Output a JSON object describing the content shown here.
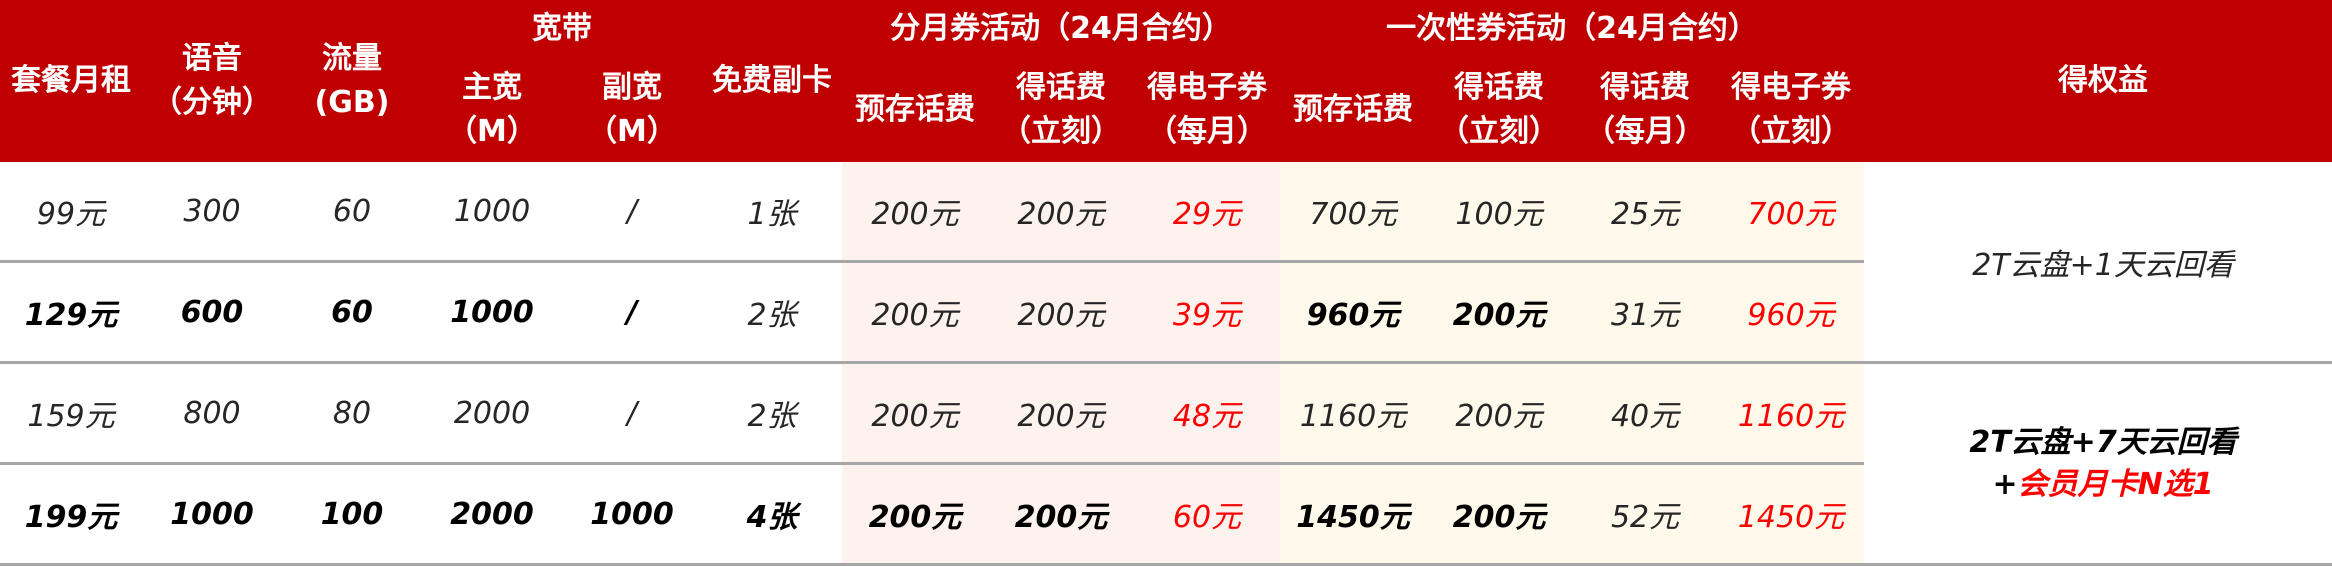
{
  "headers": {
    "monthly_fee": "套餐月租",
    "voice_l1": "语音",
    "voice_l2": "（分钟）",
    "data_l1": "流量",
    "data_l2": "(GB)",
    "broadband": "宽带",
    "main_bw_l1": "主宽",
    "main_bw_l2": "（M）",
    "sub_bw_l1": "副宽",
    "sub_bw_l2": "（M）",
    "free_card": "免费副卡",
    "monthly_coupon": "分月券活动（24月合约）",
    "onetime_coupon": "一次性券活动（24月合约）",
    "prestore": "预存话费",
    "get_fee_l1": "得话费",
    "get_fee_l2": "（立刻）",
    "get_ecoupon_l1": "得电子券",
    "get_ecoupon_monthly_l2": "（每月）",
    "prestore2": "预存话费",
    "get_fee2_l1": "得话费",
    "get_fee2_l2": "（立刻）",
    "get_fee3_l1": "得话费",
    "get_fee3_l2": "（每月）",
    "get_ecoupon2_l1": "得电子券",
    "get_ecoupon2_l2": "（立刻）",
    "benefit": "得权益"
  },
  "rows": [
    [
      "99元",
      "300",
      "60",
      "1000",
      "/",
      "1张",
      "200元",
      "200元",
      "29元",
      "700元",
      "100元",
      "25元",
      "700元"
    ],
    [
      "129元",
      "600",
      "60",
      "1000",
      "/",
      "2张",
      "200元",
      "200元",
      "39元",
      "960元",
      "200元",
      "31元",
      "960元"
    ],
    [
      "159元",
      "800",
      "80",
      "2000",
      "/",
      "2张",
      "200元",
      "200元",
      "48元",
      "1160元",
      "200元",
      "40元",
      "1160元"
    ],
    [
      "199元",
      "1000",
      "100",
      "2000",
      "1000",
      "4张",
      "200元",
      "200元",
      "60元",
      "1450元",
      "200元",
      "52元",
      "1450元"
    ]
  ],
  "benefits": {
    "group1": "2T云盘+1天云回看",
    "group2_l1": "2T云盘+7天云回看",
    "group2_l2_prefix": "+",
    "group2_l2_red": "会员月卡N选1"
  },
  "colors": {
    "header_bg": "#c00000",
    "highlight": "#ff0000",
    "pink": "#fdf2ee",
    "cream": "#fff9ec"
  }
}
